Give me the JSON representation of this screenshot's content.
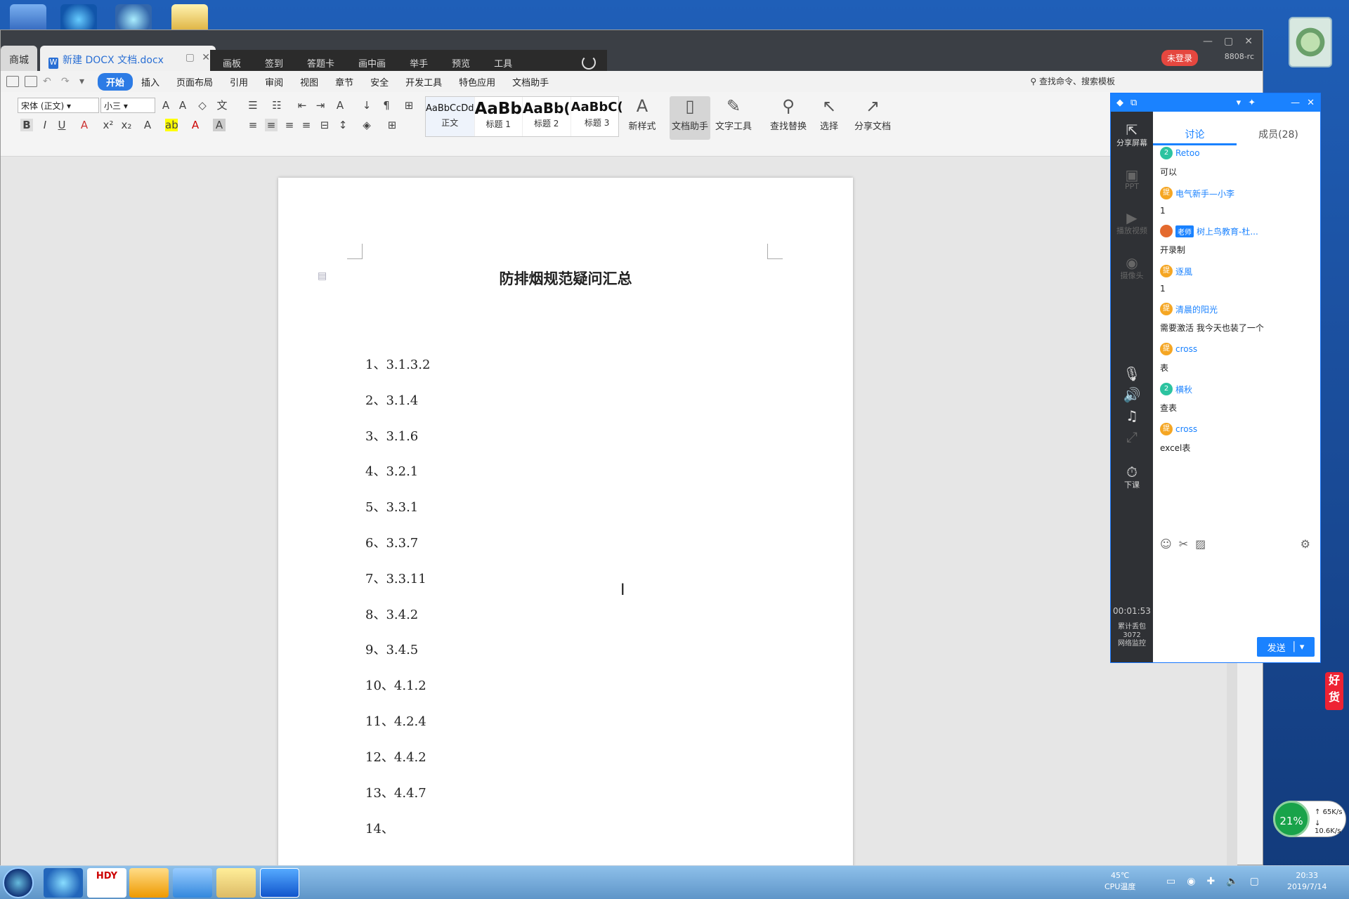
{
  "wps": {
    "left_tab": "商城",
    "doc_tab": "新建 DOCX 文档.docx",
    "overlay_tools": [
      "画板",
      "签到",
      "答题卡",
      "画中画",
      "举手",
      "预览",
      "工具"
    ],
    "unlogged": "未登录",
    "corner_num": "8808-rc",
    "menu": [
      "开始",
      "插入",
      "页面布局",
      "引用",
      "审阅",
      "视图",
      "章节",
      "安全",
      "开发工具",
      "特色应用",
      "文档助手"
    ],
    "search_cmd": "查找命令、搜索模板",
    "font_name": "宋体 (正文)",
    "font_size": "小三",
    "styles": [
      {
        "preview": "AaBbCcDd",
        "name": "正文"
      },
      {
        "preview": "AaBb",
        "name": "标题 1"
      },
      {
        "preview": "AaBb(",
        "name": "标题 2"
      },
      {
        "preview": "AaBbC(",
        "name": "标题 3"
      }
    ],
    "new_style": "新样式",
    "doc_assistant": "文档助手",
    "text_tools": "文字工具",
    "find_replace": "查找替换",
    "select": "选择",
    "share_doc": "分享文档"
  },
  "document": {
    "title": "防排烟规范疑问汇总",
    "lines": [
      "1、3.1.3.2",
      "2、3.1.4",
      "3、3.1.6",
      "4、3.2.1",
      "5、3.3.1",
      "6、3.3.7",
      "7、3.3.11",
      "8、3.4.2",
      "9、3.4.5",
      "10、4.1.2",
      "11、4.2.4",
      "12、4.4.2",
      "13、4.4.7",
      "14、"
    ]
  },
  "panel": {
    "side": [
      {
        "icon": "share-screen-icon",
        "label": "分享屏幕"
      },
      {
        "icon": "ppt-icon",
        "label": "PPT"
      },
      {
        "icon": "video-icon",
        "label": "播放视频"
      },
      {
        "icon": "camera-icon",
        "label": "摄像头"
      }
    ],
    "end_class": "下课",
    "timer": "00:01:53",
    "stats": [
      "累计丢包",
      "3072",
      "网络监控"
    ],
    "tabs": [
      "讨论",
      "成员(28)"
    ],
    "messages": [
      {
        "badge": "2",
        "color": "#2cc3a0",
        "name": "Retoo",
        "role": "",
        "text": "可以"
      },
      {
        "badge": "提",
        "color": "#f5a623",
        "name": "电气新手—小李",
        "role": "",
        "text": "1"
      },
      {
        "badge": "",
        "color": "#e46a2e",
        "name": "树上鸟教育-杜...",
        "role": "老师",
        "text": "开录制"
      },
      {
        "badge": "提",
        "color": "#f5a623",
        "name": "逐風",
        "role": "",
        "text": "1"
      },
      {
        "badge": "提",
        "color": "#f5a623",
        "name": "清晨的阳光",
        "role": "",
        "text": "需要激活 我今天也装了一个"
      },
      {
        "badge": "提",
        "color": "#f5a623",
        "name": "cross",
        "role": "",
        "text": "表"
      },
      {
        "badge": "2",
        "color": "#2cc3a0",
        "name": "横秋",
        "role": "",
        "text": "查表"
      },
      {
        "badge": "提",
        "color": "#f5a623",
        "name": "cross",
        "role": "",
        "text": "excel表"
      }
    ],
    "send": "发送"
  },
  "widgets": {
    "haohuo": "好货",
    "net_percent": "21%",
    "up": "65K/s",
    "down": "10.6K/s"
  },
  "taskbar": {
    "cpu_temp": "45℃",
    "cpu_label": "CPU温度",
    "time": "20:33",
    "date": "2019/7/14",
    "hdy": "HDY"
  }
}
